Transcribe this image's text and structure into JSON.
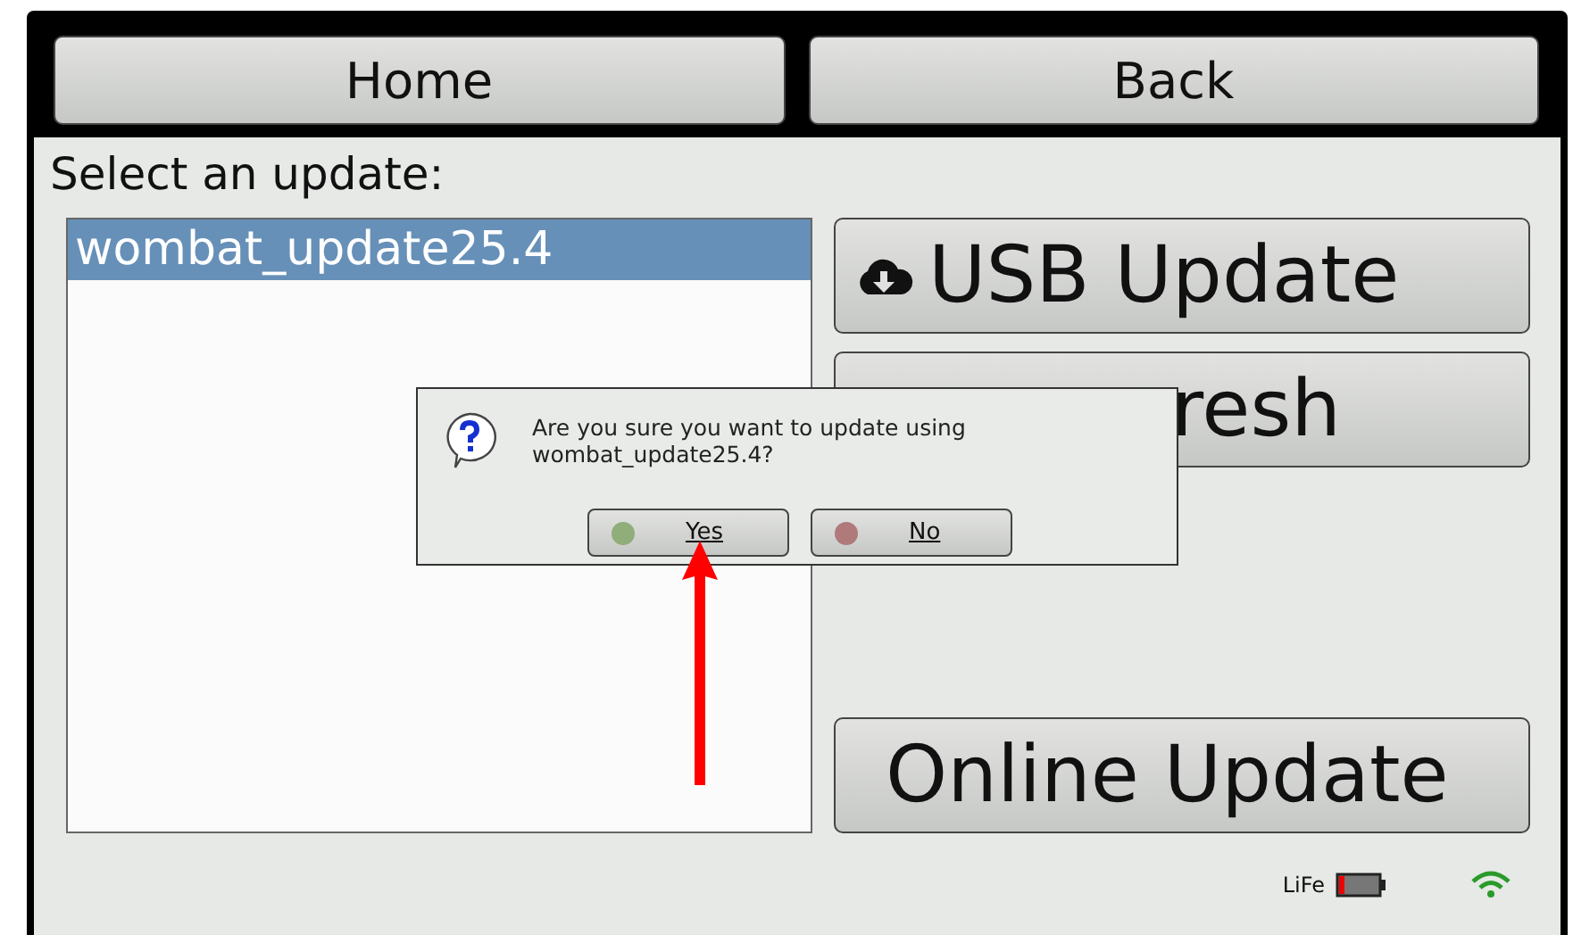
{
  "header": {
    "buttons": [
      {
        "label": "Home"
      },
      {
        "label": "Back"
      }
    ]
  },
  "prompt": "Select an update:",
  "updates": [
    {
      "label": "wombat_update25.4",
      "selected": true
    }
  ],
  "actions": [
    {
      "label": "USB Update",
      "kind": "usb"
    },
    {
      "label": "resh",
      "kind": "covered"
    },
    {
      "label": "Online Update",
      "kind": "plain"
    }
  ],
  "status_bar": {
    "battery_label": "LiFe"
  },
  "dialog": {
    "message": "Are you sure you want to update using wombat_update25.4?",
    "buttons": [
      {
        "label": "Yes",
        "color": "#8fae7a"
      },
      {
        "label": "No",
        "color": "#b07a7a"
      }
    ]
  }
}
